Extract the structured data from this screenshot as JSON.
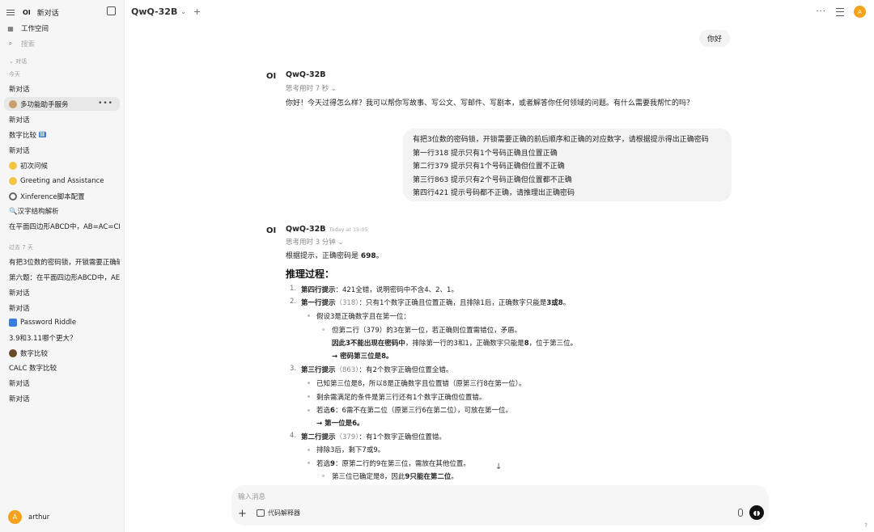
{
  "sidebar": {
    "logo": "OI",
    "new_chat": "新对话",
    "workspace": "工作空间",
    "search_placeholder": "搜索",
    "chats_label": "对话",
    "today_label": "今天",
    "today_items": [
      {
        "title": "新对话"
      },
      {
        "title": "多功能助手服务",
        "active": true,
        "more": "•••"
      },
      {
        "title": "新对话"
      },
      {
        "title": "数字比较",
        "badge": "🔢"
      },
      {
        "title": "新对话"
      },
      {
        "title": "初次问候"
      },
      {
        "title": "Greeting and Assistance"
      },
      {
        "title": "Xinference脚本配置"
      },
      {
        "title": "🔍汉字结构解析"
      },
      {
        "title": "在平面四边形ABCD中，AB=AC=CD"
      }
    ],
    "prev_label": "过去 7 天",
    "prev_items": [
      {
        "title": "有把3位数的密码锁，开锁需要正确输"
      },
      {
        "title": "第六题：在平面四边形ABCD中，AE"
      },
      {
        "title": "新对话"
      },
      {
        "title": "新对话"
      },
      {
        "title": "Password Riddle"
      },
      {
        "title": "3.9和3.11哪个更大？"
      },
      {
        "title": "数字比较"
      },
      {
        "title": "CALC 数字比较"
      },
      {
        "title": "新对话"
      },
      {
        "title": "新对话"
      }
    ],
    "user": {
      "initial": "A",
      "name": "arthur"
    }
  },
  "header": {
    "model": "QwQ-32B",
    "avatar_initial": "A"
  },
  "messages": {
    "user1": "你好",
    "ai1": {
      "name": "QwQ-32B",
      "thought": "思考用时 7 秒",
      "text": "你好！今天过得怎么样？我可以帮你写故事、写公文、写邮件、写剧本，或者解答你任何领域的问题。有什么需要我帮忙的吗？"
    },
    "user2": [
      "有把3位数的密码锁，开锁需要正确的前后顺序和正确的对应数字，请根据提示得出正确密码",
      "第一行318 提示只有1个号码正确且位置正确",
      "第二行379 提示只有1个号码正确但位置不正确",
      "第三行863 提示只有2个号码正确但位置都不正确",
      "第四行421 提示号码都不正确，请推理出正确密码"
    ],
    "ai2": {
      "name": "QwQ-32B",
      "time": "Today at 15:05",
      "thought": "思考用时 3 分钟",
      "answer_pre": "根据提示，正确密码是 ",
      "answer_val": "698",
      "answer_post": "。",
      "heading": "推理过程：",
      "s1_b": "第四行提示",
      "s1_t": "：421全错，说明密码中不含4、2、1。",
      "s2_b": "第一行提示",
      "s2_m": "（318）",
      "s2_t": "：只有1个数字正确且位置正确，且排除1后，正确数字只能是",
      "s2_b2": "3或8",
      "s2_e": "。",
      "s2_1": "假设3是正确数字且在第一位：",
      "s2_1a": "但第二行（379）的3在第一位，若正确则位置需错位，矛盾。",
      "s2_1b_b": "因此3不能出现在密码中",
      "s2_1b_t": "，排除第一行的3和1，正确数字只能是",
      "s2_1b_b2": "8",
      "s2_1b_e": "，位于第三位。",
      "s2_1c": "→ 密码第三位是8。",
      "s3_b": "第三行提示",
      "s3_m": "（863）",
      "s3_t": "：有2个数字正确但位置全错。",
      "s3_1": "已知第三位是8，所以8是正确数字且位置错（原第三行8在第一位）。",
      "s3_2": "剩余需满足的条件是第三行还有1个数字正确但位置错。",
      "s3_3_pre": "若选",
      "s3_3_b": "6",
      "s3_3_t": "：6需不在第二位（原第三行6在第二位），可放在第一位。",
      "s3_4": "→ 第一位是6。",
      "s4_b": "第二行提示",
      "s4_m": "（379）",
      "s4_t": "：有1个数字正确但位置错。",
      "s4_1": "排除3后，剩下7或9。",
      "s4_2_pre": "若选",
      "s4_2_b": "9",
      "s4_2_t": "：原第二行的9在第三位，需放在其他位置。",
      "s4_3_pre": "第三位已确定是8，因此",
      "s4_3_b": "9只能在第二位",
      "s4_3_e": "。"
    }
  },
  "composer": {
    "placeholder": "输入消息",
    "tool_label": "代码解释器"
  },
  "help": "?"
}
